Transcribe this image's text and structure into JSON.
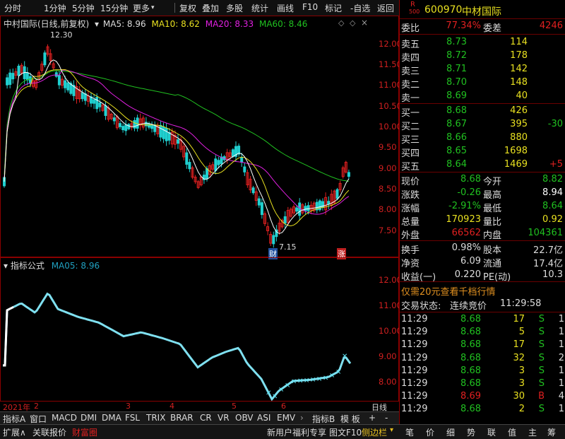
{
  "toolbar": {
    "items": [
      "分时",
      "1分钟",
      "5分钟",
      "15分钟",
      "更多",
      "复权",
      "叠加",
      "多股",
      "统计",
      "画线",
      "F10",
      "标记",
      "-自选",
      "返回"
    ],
    "more_arrow": "▾"
  },
  "chart": {
    "title": "中村国际(日线,前复权)",
    "ma5": "MA5: 8.96",
    "ma10": "MA10: 8.62",
    "ma20": "MA20: 8.33",
    "ma60": "MA60: 8.46",
    "high_mark": "12.30",
    "low_mark": "7.15",
    "cai_badge": "财",
    "zhang_badge": "涨",
    "y_labels": [
      "12.00",
      "11.50",
      "11.00",
      "10.50",
      "10.00",
      "9.50",
      "9.00",
      "8.50",
      "8.00",
      "7.50"
    ],
    "colors": {
      "ma5": "#ffffff",
      "ma10": "#e8e020",
      "ma20": "#e020e0",
      "ma60": "#20c020",
      "up": "#e02020",
      "down": "#20d0d0"
    }
  },
  "indicator": {
    "title": "指标公式",
    "ma05": "MA05: 8.96",
    "y_labels": [
      "12.00",
      "11.00",
      "10.00",
      "9.00",
      "8.00"
    ]
  },
  "xaxis": {
    "year": "2021年",
    "months": [
      "2",
      "3",
      "4",
      "5",
      "6"
    ],
    "period": "日线"
  },
  "tabs": [
    "指标A",
    "窗口",
    "MACD",
    "DMI",
    "DMA",
    "FSL",
    "TRIX",
    "BRAR",
    "CR",
    "VR",
    "OBV",
    "ASI",
    "EMV",
    "指标B",
    "模 板",
    "+",
    "-"
  ],
  "bottom": {
    "left": [
      "扩展∧",
      "关联报价",
      "财富圈"
    ],
    "promo": "新用户福利专享",
    "f10": "图文F10",
    "sidebar": "侧边栏",
    "right_tabs": [
      "笔",
      "价",
      "细",
      "势",
      "联",
      "值",
      "主",
      "筹"
    ]
  },
  "quote": {
    "r_label": "R",
    "r_sub": "500",
    "code": "600970",
    "name": "中材国际",
    "weibi_label": "委比",
    "weibi": "77.34%",
    "weicha_label": "委差",
    "weicha": "4246",
    "asks": [
      {
        "label": "卖五",
        "price": "8.73",
        "vol": "114",
        "chg": ""
      },
      {
        "label": "卖四",
        "price": "8.72",
        "vol": "178",
        "chg": ""
      },
      {
        "label": "卖三",
        "price": "8.71",
        "vol": "142",
        "chg": ""
      },
      {
        "label": "卖二",
        "price": "8.70",
        "vol": "148",
        "chg": ""
      },
      {
        "label": "卖一",
        "price": "8.69",
        "vol": "40",
        "chg": ""
      }
    ],
    "bids": [
      {
        "label": "买一",
        "price": "8.68",
        "vol": "426",
        "chg": ""
      },
      {
        "label": "买二",
        "price": "8.67",
        "vol": "395",
        "chg": "-30"
      },
      {
        "label": "买三",
        "price": "8.66",
        "vol": "880",
        "chg": ""
      },
      {
        "label": "买四",
        "price": "8.65",
        "vol": "1698",
        "chg": ""
      },
      {
        "label": "买五",
        "price": "8.64",
        "vol": "1469",
        "chg": "+5"
      }
    ],
    "stats": [
      {
        "l1": "现价",
        "v1": "8.68",
        "l2": "今开",
        "v2": "8.82"
      },
      {
        "l1": "涨跌",
        "v1": "-0.26",
        "l2": "最高",
        "v2": "8.94"
      },
      {
        "l1": "涨幅",
        "v1": "-2.91%",
        "l2": "最低",
        "v2": "8.64"
      },
      {
        "l1": "总量",
        "v1": "170923",
        "l2": "量比",
        "v2": "0.92"
      },
      {
        "l1": "外盘",
        "v1": "66562",
        "l2": "内盘",
        "v2": "104361"
      }
    ],
    "stats2": [
      {
        "l1": "换手",
        "v1": "0.98%",
        "l2": "股本",
        "v2": "22.7亿"
      },
      {
        "l1": "净资",
        "v1": "6.09",
        "l2": "流通",
        "v2": "17.4亿"
      },
      {
        "l1": "收益(一)",
        "v1": "0.220",
        "l2": "PE(动)",
        "v2": "10.3"
      }
    ],
    "promo": "仅需20元查看千档行情",
    "status_label": "交易状态:",
    "status_value": "连续竞价",
    "status_time": "11:29:58",
    "trades": [
      {
        "t": "11:29",
        "p": "8.68",
        "v": "17",
        "s": "S",
        "n": "1"
      },
      {
        "t": "11:29",
        "p": "8.68",
        "v": "5",
        "s": "S",
        "n": "1"
      },
      {
        "t": "11:29",
        "p": "8.68",
        "v": "17",
        "s": "S",
        "n": "1"
      },
      {
        "t": "11:29",
        "p": "8.68",
        "v": "32",
        "s": "S",
        "n": "2"
      },
      {
        "t": "11:29",
        "p": "8.68",
        "v": "3",
        "s": "S",
        "n": "1"
      },
      {
        "t": "11:29",
        "p": "8.68",
        "v": "3",
        "s": "S",
        "n": "1"
      },
      {
        "t": "11:29",
        "p": "8.69",
        "v": "30",
        "s": "B",
        "n": "4"
      },
      {
        "t": "11:29",
        "p": "8.68",
        "v": "2",
        "s": "S",
        "n": "1"
      }
    ]
  }
}
